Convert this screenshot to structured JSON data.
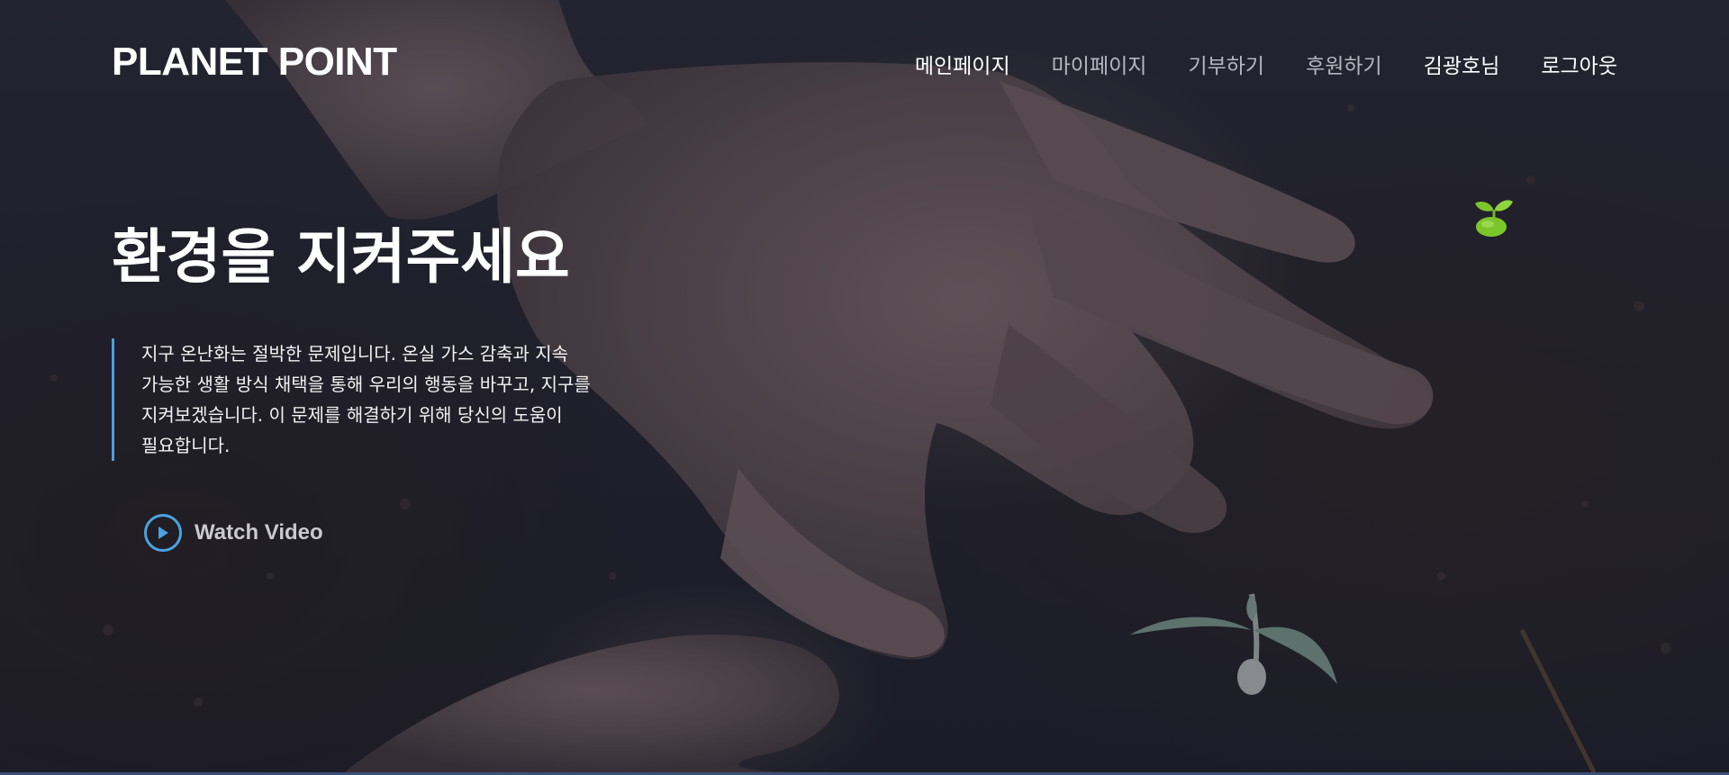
{
  "header": {
    "logo": "PLANET POINT",
    "nav": [
      {
        "label": "메인페이지",
        "active": true
      },
      {
        "label": "마이페이지",
        "active": false
      },
      {
        "label": "기부하기",
        "active": false
      },
      {
        "label": "후원하기",
        "active": false
      },
      {
        "label": "김광호님",
        "active": false
      },
      {
        "label": "로그아웃",
        "active": false
      }
    ]
  },
  "hero": {
    "headline": "환경을 지켜주세요",
    "description": "지구 온난화는 절박한 문제입니다. 온실 가스 감축과 지속 가능한 생활 방식 채택을 통해 우리의 행동을 바꾸고, 지구를 지켜보겠습니다. 이 문제를 해결하기 위해 당신의 도움이 필요합니다.",
    "watch_video": "Watch Video"
  },
  "icons": {
    "play": "play-circle-icon",
    "sprout": "sprout-icon"
  },
  "colors": {
    "accent": "#4aa3e2",
    "sprout": "#7cc62b",
    "overlay": "#161c30"
  }
}
